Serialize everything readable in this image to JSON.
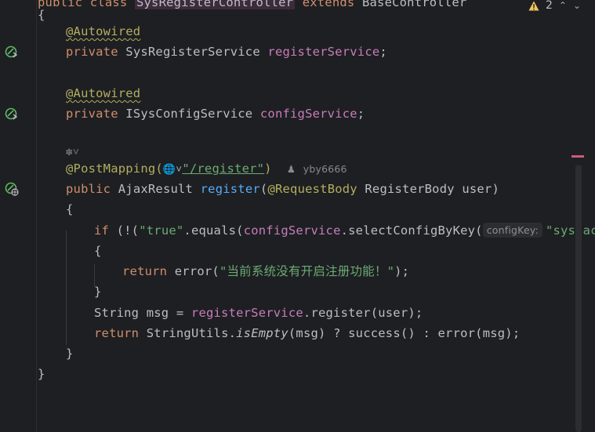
{
  "top_bar": {
    "warning_count": "2",
    "line0_public": "public",
    "line0_class": "class",
    "line0_classname": "SysRegisterController",
    "line0_extends": "extends",
    "line0_base": "BaseController",
    "line0_brace": "{"
  },
  "code": {
    "ann_autowired": "@Autowired",
    "private": "private",
    "type_register_service": "SysRegisterService",
    "field_register_service": "registerService",
    "semicolon": ";",
    "type_config_service": "ISysConfigService",
    "field_config_service": "configService",
    "ann_postmapping": "@PostMapping(",
    "mapping_path": "\"/register\"",
    "close_paren": ")",
    "author_name": "yby6666",
    "public": "public",
    "return_type": "AjaxResult",
    "method_name": "register",
    "param_ann": "@RequestBody",
    "param_type": "RegisterBody",
    "param_name": "user)",
    "open_brace": "{",
    "close_brace": "}",
    "if_kw": "if",
    "if_open": " (!(",
    "str_true": "\"true\"",
    "equals_call": ".equals(",
    "config_field": "configService",
    "select_call": ".selectConfigByKey(",
    "hint_label": "configKey:",
    "str_key": "\"sys.acco",
    "return_kw": "return",
    "error_call": "error(",
    "error_msg": "\"当前系统没有开启注册功能！\"",
    "error_close": ");",
    "string_decl": "String msg = ",
    "register_field": "registerService",
    "register_call": ".register(user);",
    "string_utils": "StringUtils.",
    "is_empty": "isEmpty",
    "ternary_rest": "(msg) ? success() : error(msg);"
  },
  "colors": {
    "background": "#1e1f22",
    "keyword": "#cf8e6d",
    "annotation": "#b3ae60",
    "field": "#c77dbb",
    "function": "#57aaf7",
    "string": "#6aab73",
    "gutter_icon": "#5fb865"
  },
  "icons": {
    "warning": "warning-triangle-icon",
    "prev": "chevron-up-icon",
    "next": "chevron-down-icon",
    "bean": "spring-bean-icon",
    "web": "web-endpoint-icon",
    "author": "person-icon",
    "ai": "ai-assistant-icon"
  }
}
